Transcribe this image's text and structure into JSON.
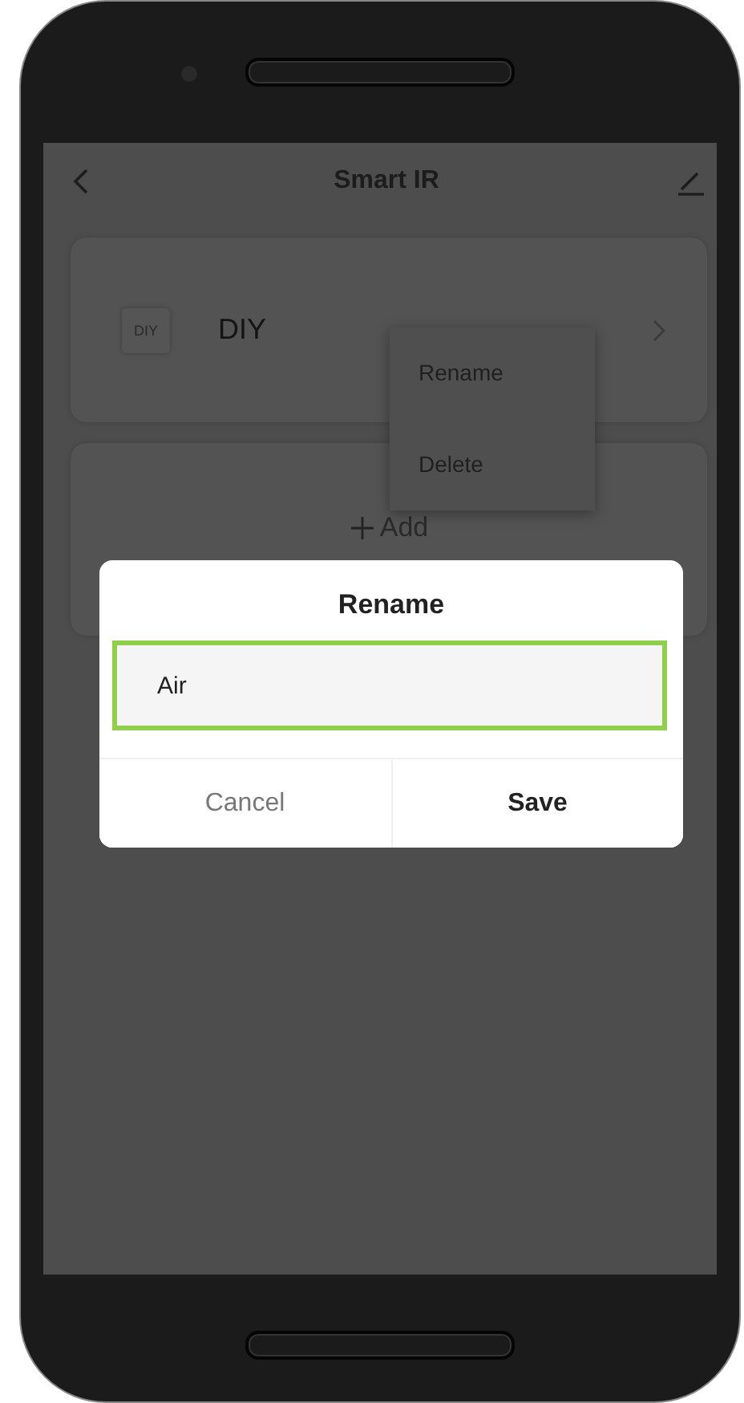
{
  "header": {
    "title": "Smart IR"
  },
  "devices": [
    {
      "badge": "DIY",
      "name": "DIY"
    }
  ],
  "add_button": {
    "label": "Add"
  },
  "context_menu": {
    "items": [
      {
        "label": "Rename"
      },
      {
        "label": "Delete"
      }
    ]
  },
  "dialog": {
    "title": "Rename",
    "input": {
      "value": "Air",
      "focused": true
    },
    "buttons": [
      {
        "label": "Cancel",
        "kind": "secondary"
      },
      {
        "label": "Save",
        "kind": "primary"
      }
    ]
  }
}
